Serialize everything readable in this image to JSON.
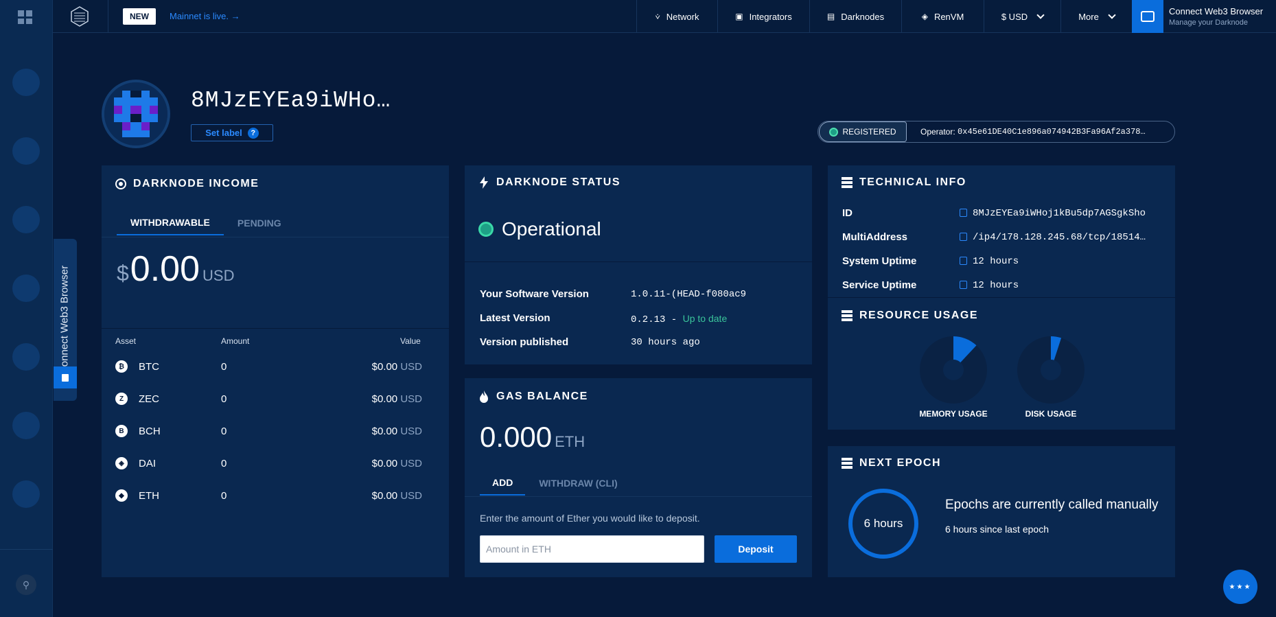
{
  "topbar": {
    "new_badge": "NEW",
    "announcement": "Mainnet is live. →",
    "nav": [
      {
        "label": "Network",
        "icon": "share-icon"
      },
      {
        "label": "Integrators",
        "icon": "book-icon"
      },
      {
        "label": "Darknodes",
        "icon": "server-icon"
      },
      {
        "label": "RenVM",
        "icon": "layers-icon"
      },
      {
        "label": "$ USD",
        "icon": "chevron-down-icon"
      },
      {
        "label": "More",
        "icon": "chevron-down-icon"
      }
    ],
    "connect_title": "Connect Web3 Browser",
    "connect_subtitle": "Manage your Darknode"
  },
  "sidebar": {
    "connect_tab": "Connect Web3 Browser"
  },
  "header": {
    "node_id": "8MJzEYEa9iWHo…",
    "set_label": "Set label",
    "help": "?",
    "status": "REGISTERED",
    "operator_label": "Operator:",
    "operator_address": "0x45e61DE40C1e896a074942B3Fa96Af2a378…"
  },
  "income": {
    "title": "DARKNODE INCOME",
    "tabs": [
      "WITHDRAWABLE",
      "PENDING"
    ],
    "currency_symbol": "$",
    "amount": "0.00",
    "unit": "USD",
    "columns": [
      "Asset",
      "Amount",
      "Value"
    ],
    "assets": [
      {
        "symbol": "BTC",
        "amount": "0",
        "value": "$0.00",
        "value_unit": "USD",
        "glyph": "₿"
      },
      {
        "symbol": "ZEC",
        "amount": "0",
        "value": "$0.00",
        "value_unit": "USD",
        "glyph": "Z"
      },
      {
        "symbol": "BCH",
        "amount": "0",
        "value": "$0.00",
        "value_unit": "USD",
        "glyph": "B"
      },
      {
        "symbol": "DAI",
        "amount": "0",
        "value": "$0.00",
        "value_unit": "USD",
        "glyph": "◈"
      },
      {
        "symbol": "ETH",
        "amount": "0",
        "value": "$0.00",
        "value_unit": "USD",
        "glyph": "◆"
      }
    ]
  },
  "status": {
    "title": "DARKNODE STATUS",
    "state": "Operational",
    "rows": [
      {
        "label": "Your Software Version",
        "value": "1.0.11-(HEAD-f080ac9"
      },
      {
        "label": "Latest Version",
        "value": "0.2.13 - ",
        "extra": "Up to date"
      },
      {
        "label": "Version published",
        "value": "30 hours ago"
      }
    ]
  },
  "gas": {
    "title": "GAS BALANCE",
    "amount": "0.000",
    "unit": "ETH",
    "tabs": [
      "ADD",
      "WITHDRAW (CLI)"
    ],
    "hint": "Enter the amount of Ether you would like to deposit.",
    "input_placeholder": "Amount in ETH",
    "deposit_label": "Deposit"
  },
  "technical": {
    "title": "TECHNICAL INFO",
    "rows": [
      {
        "label": "ID",
        "value": "8MJzEYEa9iWHoj1kBu5dp7AGSgkSho"
      },
      {
        "label": "MultiAddress",
        "value": "/ip4/178.128.245.68/tcp/18514…"
      },
      {
        "label": "System Uptime",
        "value": "12 hours"
      },
      {
        "label": "Service Uptime",
        "value": "12 hours"
      }
    ]
  },
  "resources": {
    "title": "RESOURCE USAGE",
    "memory_label": "MEMORY USAGE",
    "disk_label": "DISK USAGE",
    "memory_fraction": 0.12,
    "disk_fraction": 0.05
  },
  "epoch": {
    "title": "NEXT EPOCH",
    "ring_label": "6 hours",
    "headline": "Epochs are currently called manually",
    "subtext": "6 hours since last epoch"
  },
  "colors": {
    "background": "#061a3a",
    "card": "#0a2850",
    "accent": "#0a6ddc",
    "status_green": "#1ea086"
  }
}
